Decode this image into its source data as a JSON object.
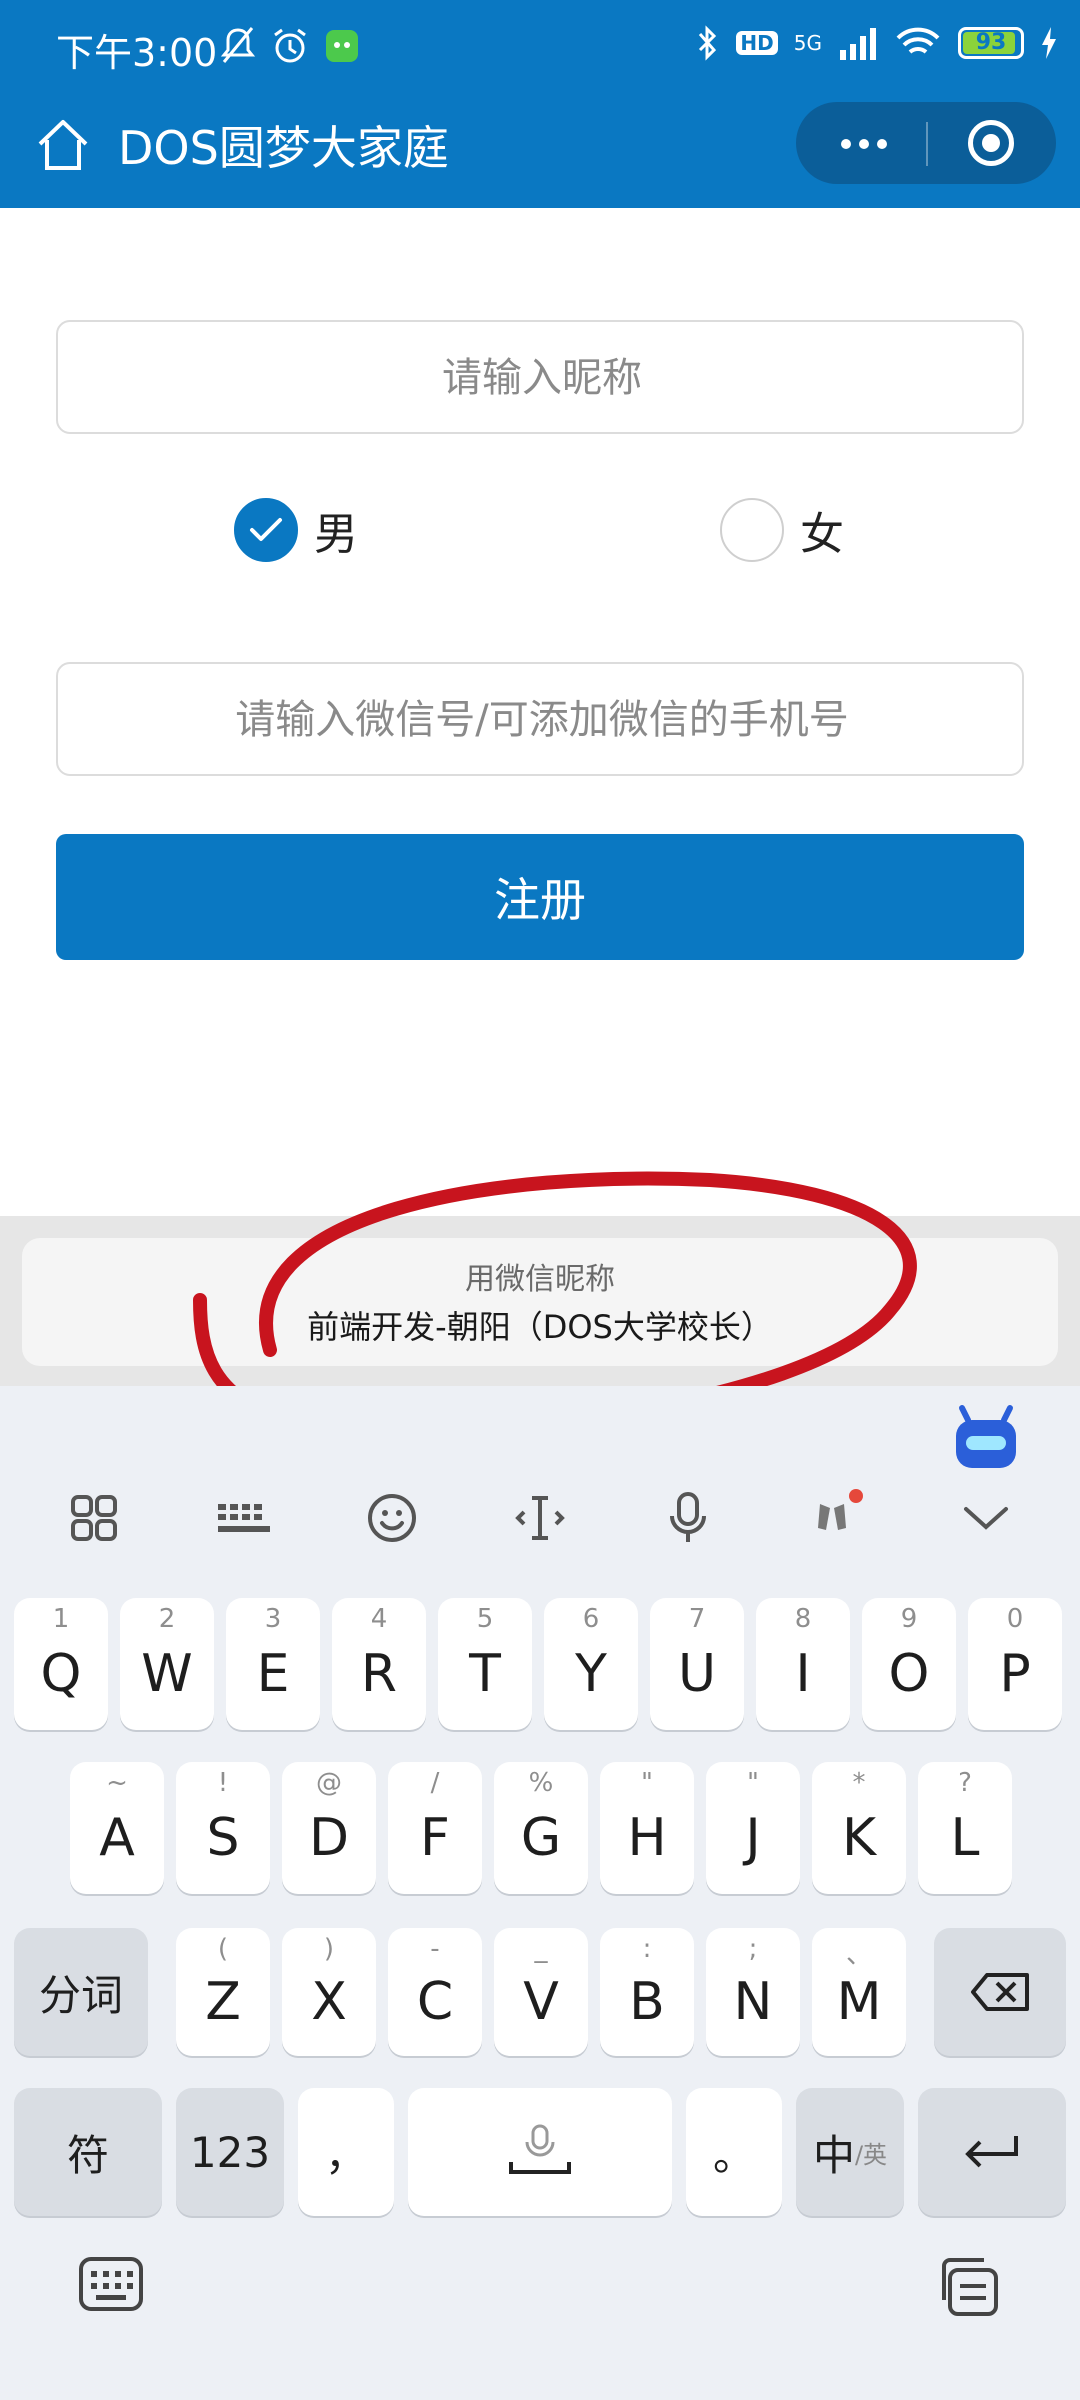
{
  "status_bar": {
    "time": "下午3:00",
    "network": "5G",
    "hd": "HD",
    "battery": "93",
    "battery_level": 0.93
  },
  "header": {
    "title": "DOS圆梦大家庭",
    "icons": [
      "home-icon",
      "more-icon",
      "close-mini-program-icon"
    ],
    "color": "#0a78c2"
  },
  "form": {
    "nickname_placeholder": "请输入昵称",
    "gender": {
      "male_label": "男",
      "female_label": "女",
      "selected": "男"
    },
    "wechat_placeholder": "请输入微信号/可添加微信的手机号",
    "register_label": "注册"
  },
  "suggestion": {
    "title": "用微信昵称",
    "name": "前端开发-朝阳（DOS大学校长）"
  },
  "keyboard": {
    "toolbar": [
      "grid-icon",
      "keyboard-icon",
      "emoji-icon",
      "cursor-icon",
      "mic-icon",
      "celebration-icon",
      "collapse-icon"
    ],
    "row1": [
      {
        "hint": "1",
        "key": "Q"
      },
      {
        "hint": "2",
        "key": "W"
      },
      {
        "hint": "3",
        "key": "E"
      },
      {
        "hint": "4",
        "key": "R"
      },
      {
        "hint": "5",
        "key": "T"
      },
      {
        "hint": "6",
        "key": "Y"
      },
      {
        "hint": "7",
        "key": "U"
      },
      {
        "hint": "8",
        "key": "I"
      },
      {
        "hint": "9",
        "key": "O"
      },
      {
        "hint": "0",
        "key": "P"
      }
    ],
    "row2": [
      {
        "hint": "~",
        "key": "A"
      },
      {
        "hint": "!",
        "key": "S"
      },
      {
        "hint": "@",
        "key": "D"
      },
      {
        "hint": "/",
        "key": "F"
      },
      {
        "hint": "%",
        "key": "G"
      },
      {
        "hint": "\"",
        "key": "H"
      },
      {
        "hint": "\"",
        "key": "J"
      },
      {
        "hint": "*",
        "key": "K"
      },
      {
        "hint": "?",
        "key": "L"
      }
    ],
    "row3_left": "分词",
    "row3": [
      {
        "hint": "(",
        "key": "Z"
      },
      {
        "hint": ")",
        "key": "X"
      },
      {
        "hint": "-",
        "key": "C"
      },
      {
        "hint": "_",
        "key": "V"
      },
      {
        "hint": ":",
        "key": "B"
      },
      {
        "hint": ";",
        "key": "N"
      },
      {
        "hint": "、",
        "key": "M"
      }
    ],
    "row4": {
      "symbols": "符",
      "numbers": "123",
      "comma": "，",
      "period": "。",
      "lang_main": "中",
      "lang_sub": "/英"
    }
  }
}
